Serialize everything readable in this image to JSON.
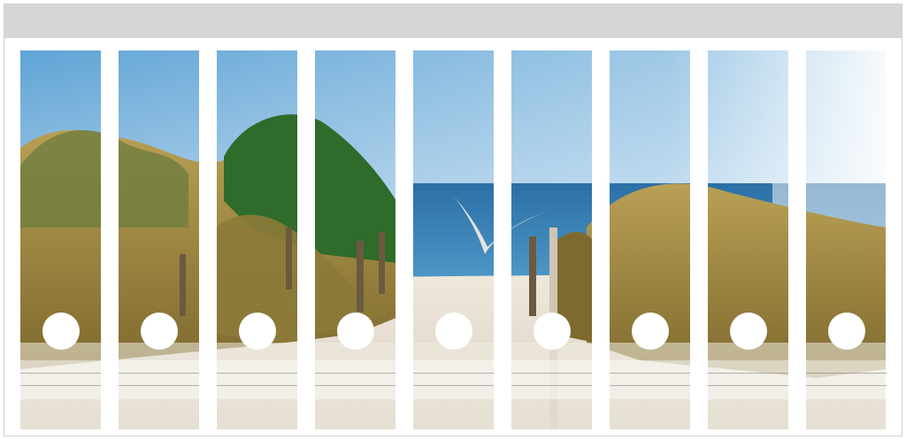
{
  "sheet": {
    "strip_count": 9,
    "colors": {
      "header": "#d6d6d6",
      "sky_top": "#5fa4d6",
      "sky_bottom": "#f3f7fb",
      "sea": "#2f7fb5",
      "sand": "#e9e2d6",
      "grass": "#a58a3c",
      "bush": "#2f6b2a"
    }
  },
  "strips": [
    {
      "icon": "finger-hole"
    },
    {
      "icon": "finger-hole"
    },
    {
      "icon": "finger-hole"
    },
    {
      "icon": "finger-hole"
    },
    {
      "icon": "finger-hole"
    },
    {
      "icon": "finger-hole"
    },
    {
      "icon": "finger-hole"
    },
    {
      "icon": "finger-hole"
    },
    {
      "icon": "finger-hole"
    }
  ]
}
